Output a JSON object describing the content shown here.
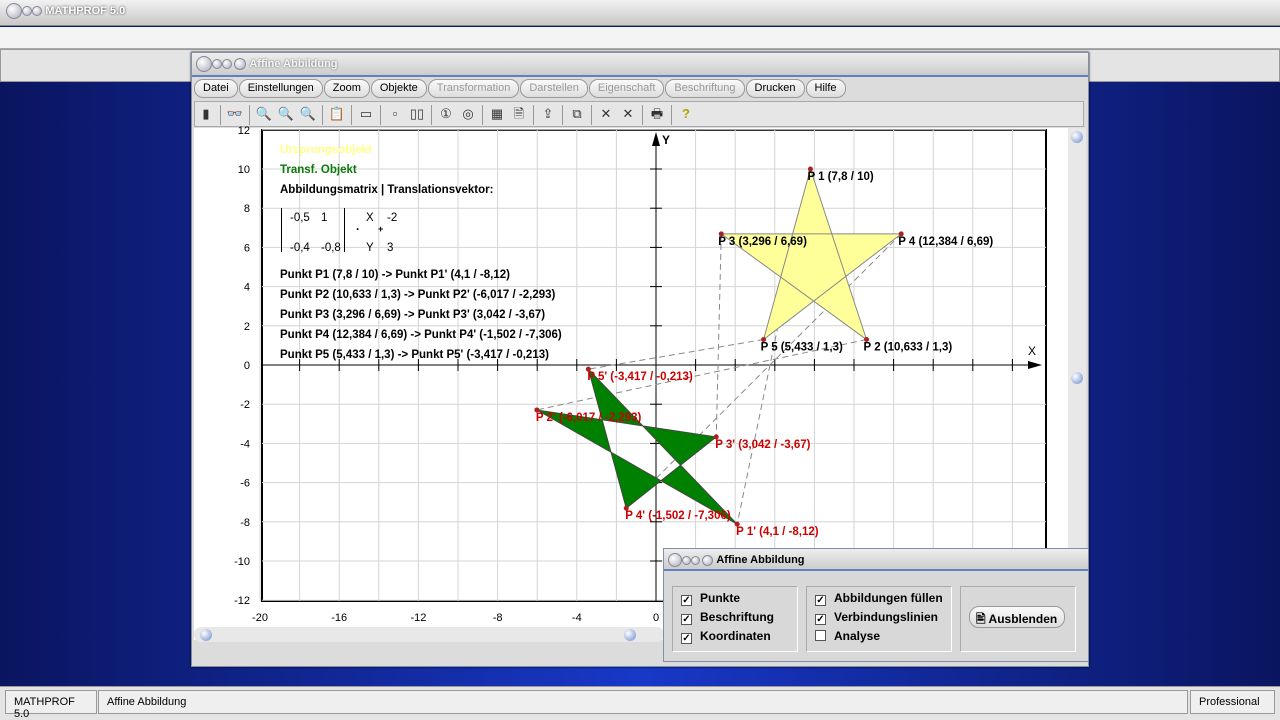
{
  "app": {
    "title": "MATHPROF 5.0"
  },
  "window": {
    "title": "Affine Abbildung"
  },
  "menu": [
    {
      "label": "Datei",
      "enabled": true
    },
    {
      "label": "Einstellungen",
      "enabled": true
    },
    {
      "label": "Zoom",
      "enabled": true
    },
    {
      "label": "Objekte",
      "enabled": true
    },
    {
      "label": "Transformation",
      "enabled": false
    },
    {
      "label": "Darstellen",
      "enabled": false
    },
    {
      "label": "Eigenschaft",
      "enabled": false
    },
    {
      "label": "Beschriftung",
      "enabled": false
    },
    {
      "label": "Drucken",
      "enabled": true
    },
    {
      "label": "Hilfe",
      "enabled": true
    }
  ],
  "toolbar": [
    "window-toggle-icon",
    "glasses-icon",
    "zoom-out-icon",
    "zoom-icon",
    "zoom-in-icon",
    "properties-icon",
    "layout-icon",
    "frame-icon",
    "frame-double-icon",
    "circle-1-icon",
    "circle-2-icon",
    "table-icon",
    "document-icon",
    "export-icon",
    "copy-icon",
    "cross-icon",
    "cross-double-icon",
    "printer-icon",
    "help-icon"
  ],
  "overlay": {
    "legend_original": "Ursprungsobjekt",
    "legend_transformed": "Transf. Objekt",
    "matrix_title": "Abbildungsmatrix | Translationsvektor:",
    "m11": "-0,5",
    "m12": "1",
    "m21": "-0,4",
    "m22": "-0,8",
    "vx": "X",
    "vy": "Y",
    "t1": "-2",
    "t2": "3",
    "dot": "·",
    "plus": "+",
    "lines": [
      "Punkt P1 (7,8 / 10) -> Punkt P1' (4,1 / -8,12)",
      "Punkt P2 (10,633 / 1,3) -> Punkt P2' (-6,017 / -2,293)",
      "Punkt P3 (3,296 / 6,69) -> Punkt P3' (3,042 / -3,67)",
      "Punkt P4 (12,384 / 6,69) -> Punkt P4' (-1,502 / -7,306)",
      "Punkt P5 (5,433 / 1,3) -> Punkt P5' (-3,417 / -0,213)"
    ]
  },
  "chart_data": {
    "type": "scatter",
    "xlabel": "X",
    "ylabel": "Y",
    "xlim": [
      -20,
      19.7
    ],
    "ylim": [
      -12,
      12
    ],
    "grid": true,
    "grid_step": 2,
    "xticks": [
      -20,
      -16,
      -12,
      -8,
      -4,
      0
    ],
    "yticks": [
      -12,
      -10,
      -8,
      -6,
      -4,
      -2,
      0,
      2,
      4,
      6,
      8,
      10,
      12
    ],
    "colors": {
      "original_fill": "#ffff99",
      "transformed_fill": "#008000",
      "label_original": "#000000",
      "label_transformed": "#cc0000",
      "point": "#aa2222"
    },
    "original": [
      {
        "label": "P 1 (7,8 / 10)",
        "x": 7.8,
        "y": 10
      },
      {
        "label": "P 2 (10,633 / 1,3)",
        "x": 10.633,
        "y": 1.3
      },
      {
        "label": "P 3 (3,296 / 6,69)",
        "x": 3.296,
        "y": 6.69
      },
      {
        "label": "P 4 (12,384 / 6,69)",
        "x": 12.384,
        "y": 6.69
      },
      {
        "label": "P 5 (5,433 / 1,3)",
        "x": 5.433,
        "y": 1.3
      }
    ],
    "transformed": [
      {
        "label": "P 1' (4,1 / -8,12)",
        "x": 4.1,
        "y": -8.12
      },
      {
        "label": "P 2' (-6,017 / -2,293)",
        "x": -6.017,
        "y": -2.293
      },
      {
        "label": "P 3' (3,042 / -3,67)",
        "x": 3.042,
        "y": -3.67
      },
      {
        "label": "P 4' (-1,502 / -7,306)",
        "x": -1.502,
        "y": -7.306
      },
      {
        "label": "P 5' (-3,417 / -0,213)",
        "x": -3.417,
        "y": -0.213
      }
    ]
  },
  "dialog": {
    "title": "Affine Abbildung",
    "checks": [
      {
        "label": "Punkte",
        "checked": true
      },
      {
        "label": "Beschriftung",
        "checked": true
      },
      {
        "label": "Koordinaten",
        "checked": true
      },
      {
        "label": "Abbildungen füllen",
        "checked": true
      },
      {
        "label": "Verbindungslinien",
        "checked": true
      },
      {
        "label": "Analyse",
        "checked": false
      }
    ],
    "button": "Ausblenden"
  },
  "status": {
    "app": "MATHPROF 5.0",
    "module": "Affine Abbildung",
    "edition": "Professional"
  }
}
